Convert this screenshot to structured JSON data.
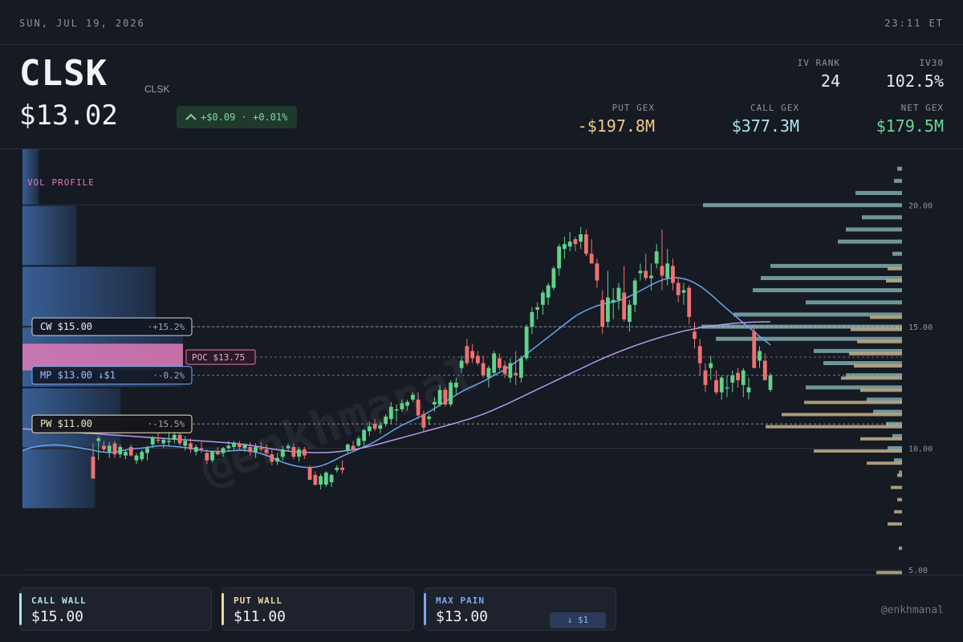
{
  "topbar": {
    "date": "SUN, JUL 19, 2026",
    "time": "23:11 ET"
  },
  "header": {
    "ticker": "CLSK",
    "company": "CLSK",
    "price": "$13.02",
    "change": "+$0.09 · +0.01%",
    "stats": {
      "iv_rank_label": "IV RANK",
      "iv_rank": "24",
      "iv30_label": "IV30",
      "iv30": "102.5%",
      "put_gex_label": "PUT GEX",
      "put_gex": "-$197.8M",
      "call_gex_label": "CALL GEX",
      "call_gex": "$377.3M",
      "net_gex_label": "NET GEX",
      "net_gex": "$179.5M"
    }
  },
  "colors": {
    "up": "#5fd38a",
    "down": "#f07272",
    "call": "#a9e7ee",
    "put": "#f0d9a0",
    "max_pain": "#7aa8f0",
    "poc": "#e07bb8",
    "net_gex": "#6fd59a",
    "put_gex": "#f0c98a"
  },
  "chart_data": {
    "type": "candlestick",
    "title": "",
    "ylim": [
      4.8,
      22.3
    ],
    "y_ticks": [
      "20.00",
      "15.00",
      "10.00",
      "5.00"
    ],
    "volume_profile_label": "VOL PROFILE",
    "levels": [
      {
        "key": "cw",
        "label": "CW $15.00",
        "pct": "+15.2%",
        "price": 15.0
      },
      {
        "key": "mp",
        "label": "MP $13.00 ↓$1",
        "pct": "-0.2%",
        "price": 13.0
      },
      {
        "key": "pw",
        "label": "PW $11.00",
        "pct": "-15.5%",
        "price": 11.0
      },
      {
        "key": "poc",
        "label": "POC $13.75",
        "price": 13.75
      }
    ],
    "volume_profile": [
      {
        "from": 20.0,
        "to": 22.5,
        "value": 0.16
      },
      {
        "from": 17.5,
        "to": 20.0,
        "value": 0.53
      },
      {
        "from": 15.0,
        "to": 17.5,
        "value": 1.3
      },
      {
        "from": 12.5,
        "to": 15.0,
        "value": 1.57
      },
      {
        "from": 10.0,
        "to": 12.5,
        "value": 0.96
      },
      {
        "from": 7.5,
        "to": 10.0,
        "value": 0.71
      }
    ],
    "candles_ohlc": [
      [
        9.65,
        10.2,
        8.75,
        8.75
      ],
      [
        10.3,
        10.5,
        9.5,
        10.4
      ],
      [
        10.1,
        10.3,
        9.85,
        9.95
      ],
      [
        9.85,
        10.25,
        9.6,
        10.1
      ],
      [
        10.2,
        10.3,
        9.6,
        9.75
      ],
      [
        9.75,
        10.15,
        9.6,
        10.05
      ],
      [
        9.7,
        9.95,
        9.55,
        9.85
      ],
      [
        10.05,
        10.15,
        9.65,
        9.7
      ],
      [
        9.5,
        9.8,
        9.35,
        9.7
      ],
      [
        9.55,
        9.95,
        9.45,
        9.85
      ],
      [
        9.8,
        10.1,
        9.5,
        10.0
      ],
      [
        10.15,
        10.5,
        10.0,
        10.45
      ],
      [
        10.35,
        10.65,
        10.2,
        10.3
      ],
      [
        10.2,
        10.4,
        10.0,
        10.35
      ],
      [
        10.25,
        10.7,
        10.1,
        10.3
      ],
      [
        10.35,
        10.7,
        10.2,
        10.55
      ],
      [
        10.55,
        10.7,
        10.1,
        10.2
      ],
      [
        10.1,
        10.5,
        9.9,
        10.3
      ],
      [
        10.2,
        10.4,
        9.8,
        9.95
      ],
      [
        9.85,
        10.15,
        9.7,
        10.05
      ],
      [
        10.0,
        10.3,
        9.8,
        9.95
      ],
      [
        9.8,
        9.95,
        9.35,
        9.5
      ],
      [
        9.5,
        9.9,
        9.4,
        9.85
      ],
      [
        9.85,
        10.05,
        9.7,
        9.75
      ],
      [
        9.8,
        10.05,
        9.65,
        10.0
      ],
      [
        10.0,
        10.3,
        9.85,
        10.1
      ],
      [
        10.05,
        10.3,
        9.9,
        10.2
      ],
      [
        10.2,
        10.3,
        9.9,
        10.05
      ],
      [
        10.0,
        10.2,
        9.85,
        10.15
      ],
      [
        10.05,
        10.25,
        9.7,
        9.85
      ],
      [
        9.85,
        10.2,
        9.6,
        10.05
      ],
      [
        10.0,
        10.25,
        9.85,
        9.95
      ],
      [
        9.95,
        10.15,
        9.65,
        9.8
      ],
      [
        9.75,
        10.0,
        9.3,
        9.45
      ],
      [
        9.45,
        9.8,
        9.3,
        9.6
      ],
      [
        9.65,
        10.1,
        9.5,
        9.95
      ],
      [
        10.0,
        10.2,
        9.9,
        10.1
      ],
      [
        10.05,
        10.2,
        9.55,
        9.65
      ],
      [
        9.65,
        10.05,
        9.45,
        9.95
      ],
      [
        9.95,
        10.05,
        9.55,
        9.7
      ],
      [
        9.2,
        9.3,
        8.7,
        8.7
      ],
      [
        8.9,
        9.05,
        8.45,
        8.5
      ],
      [
        8.5,
        8.95,
        8.3,
        8.85
      ],
      [
        8.5,
        9.05,
        8.4,
        9.0
      ],
      [
        8.6,
        8.95,
        8.4,
        8.9
      ],
      [
        9.1,
        9.3,
        9.0,
        9.2
      ],
      [
        9.2,
        9.5,
        8.95,
        9.1
      ],
      [
        9.9,
        10.2,
        9.8,
        10.15
      ],
      [
        10.1,
        10.3,
        9.9,
        9.95
      ],
      [
        10.1,
        10.5,
        10.05,
        10.4
      ],
      [
        10.3,
        10.8,
        10.0,
        10.75
      ],
      [
        10.7,
        11.1,
        10.5,
        10.9
      ],
      [
        11.0,
        11.2,
        10.7,
        10.8
      ],
      [
        10.8,
        11.1,
        10.6,
        10.95
      ],
      [
        11.0,
        11.4,
        10.9,
        11.3
      ],
      [
        11.2,
        11.9,
        11.0,
        11.7
      ],
      [
        11.6,
        11.8,
        11.1,
        11.6
      ],
      [
        11.6,
        12.0,
        11.5,
        11.85
      ],
      [
        11.75,
        12.0,
        11.55,
        11.9
      ],
      [
        12.0,
        12.3,
        11.9,
        12.2
      ],
      [
        12.0,
        12.3,
        11.2,
        11.35
      ],
      [
        11.4,
        11.55,
        10.7,
        10.85
      ],
      [
        11.2,
        11.4,
        10.95,
        11.3
      ],
      [
        11.8,
        12.1,
        11.5,
        11.9
      ],
      [
        11.8,
        12.6,
        11.7,
        12.4
      ],
      [
        12.4,
        12.5,
        11.7,
        11.8
      ],
      [
        11.8,
        12.8,
        11.7,
        12.7
      ],
      [
        12.5,
        12.9,
        12.2,
        12.7
      ],
      [
        13.3,
        13.8,
        13.1,
        13.6
      ],
      [
        14.2,
        14.5,
        13.4,
        13.5
      ],
      [
        14.0,
        14.3,
        13.5,
        13.7
      ],
      [
        13.8,
        14.0,
        13.4,
        13.5
      ],
      [
        13.5,
        13.8,
        12.9,
        13.0
      ],
      [
        12.9,
        13.4,
        12.5,
        13.3
      ],
      [
        13.1,
        14.0,
        13.0,
        13.9
      ],
      [
        13.7,
        13.9,
        13.2,
        13.3
      ],
      [
        13.4,
        13.6,
        12.9,
        13.05
      ],
      [
        12.9,
        13.7,
        12.7,
        13.5
      ],
      [
        13.1,
        14.0,
        12.6,
        13.0
      ],
      [
        12.9,
        13.8,
        12.7,
        13.7
      ],
      [
        13.7,
        15.1,
        13.6,
        15.0
      ],
      [
        15.0,
        15.8,
        14.7,
        15.6
      ],
      [
        15.7,
        16.0,
        15.3,
        15.8
      ],
      [
        15.9,
        16.5,
        15.5,
        16.4
      ],
      [
        16.2,
        16.8,
        15.9,
        16.7
      ],
      [
        16.6,
        17.5,
        16.5,
        17.4
      ],
      [
        17.4,
        18.4,
        17.1,
        18.3
      ],
      [
        18.2,
        18.7,
        17.8,
        18.4
      ],
      [
        18.3,
        18.9,
        18.1,
        18.5
      ],
      [
        18.6,
        18.7,
        18.1,
        18.4
      ],
      [
        18.5,
        19.1,
        18.2,
        18.8
      ],
      [
        18.8,
        19.0,
        17.9,
        18.0
      ],
      [
        18.0,
        18.6,
        17.6,
        17.6
      ],
      [
        17.6,
        17.8,
        16.6,
        16.9
      ],
      [
        16.1,
        16.5,
        14.7,
        15.0
      ],
      [
        15.2,
        17.3,
        15.0,
        16.2
      ],
      [
        16.0,
        16.6,
        15.3,
        16.1
      ],
      [
        16.1,
        16.8,
        15.7,
        16.6
      ],
      [
        16.4,
        17.5,
        15.2,
        15.3
      ],
      [
        15.2,
        16.1,
        14.8,
        15.9
      ],
      [
        15.9,
        17.0,
        15.6,
        16.9
      ],
      [
        17.2,
        17.6,
        16.9,
        17.3
      ],
      [
        17.3,
        18.0,
        16.9,
        17.0
      ],
      [
        17.0,
        17.6,
        16.5,
        17.1
      ],
      [
        17.6,
        18.4,
        17.4,
        18.1
      ],
      [
        17.5,
        19.0,
        16.5,
        17.1
      ],
      [
        17.0,
        18.2,
        16.7,
        17.6
      ],
      [
        17.5,
        17.8,
        16.5,
        16.8
      ],
      [
        16.8,
        17.0,
        16.0,
        16.3
      ],
      [
        16.4,
        16.8,
        15.9,
        16.5
      ],
      [
        16.6,
        16.7,
        15.1,
        15.4
      ],
      [
        14.8,
        15.2,
        14.1,
        14.5
      ],
      [
        14.2,
        14.5,
        13.0,
        13.5
      ],
      [
        13.2,
        13.5,
        12.3,
        12.6
      ],
      [
        13.3,
        13.8,
        12.8,
        13.5
      ],
      [
        12.8,
        13.2,
        12.2,
        12.3
      ],
      [
        12.3,
        13.0,
        12.0,
        12.9
      ],
      [
        12.5,
        13.0,
        12.1,
        12.5
      ],
      [
        12.7,
        13.2,
        12.3,
        13.0
      ],
      [
        13.1,
        13.3,
        12.5,
        12.8
      ],
      [
        12.6,
        13.3,
        12.1,
        13.2
      ],
      [
        12.3,
        12.9,
        12.0,
        12.5
      ],
      [
        14.8,
        15.1,
        13.3,
        13.3
      ],
      [
        13.6,
        14.2,
        13.3,
        14.0
      ],
      [
        13.6,
        13.9,
        12.8,
        12.8
      ],
      [
        12.4,
        13.1,
        12.3,
        13.0
      ]
    ],
    "moving_averages": [
      {
        "name": "fast",
        "values": [
          9.9,
          10.0,
          10.05,
          10.1,
          10.12,
          10.14,
          10.13,
          10.1,
          10.06,
          10.02,
          9.98,
          9.94,
          9.88,
          9.84,
          9.82,
          9.85,
          9.9,
          9.95,
          9.98,
          10.0,
          10.03,
          10.07,
          10.1,
          10.1,
          10.08,
          10.06,
          10.03,
          10.0,
          9.95,
          9.9,
          9.88,
          9.87,
          9.87,
          9.88,
          9.9,
          9.92,
          9.9,
          9.86,
          9.8,
          9.72,
          9.62,
          9.5,
          9.4,
          9.32,
          9.26,
          9.22,
          9.2,
          9.22,
          9.28,
          9.38,
          9.5,
          9.63,
          9.75,
          9.86,
          9.97,
          10.08,
          10.2,
          10.34,
          10.5,
          10.66,
          10.82,
          10.96,
          11.08,
          11.2,
          11.32,
          11.46,
          11.62,
          11.78,
          11.94,
          12.1,
          12.26,
          12.4,
          12.52,
          12.64,
          12.76,
          12.9,
          13.04,
          13.18,
          13.34,
          13.52,
          13.7,
          13.9,
          14.1,
          14.3,
          14.5,
          14.7,
          14.9,
          15.1,
          15.3,
          15.48,
          15.62,
          15.74,
          15.84,
          15.92,
          15.98,
          16.02,
          16.1,
          16.2,
          16.32,
          16.46,
          16.6,
          16.74,
          16.86,
          16.95,
          17.0,
          17.02,
          16.98,
          16.9,
          16.78,
          16.62,
          16.42,
          16.2,
          15.96,
          15.74,
          15.52,
          15.3,
          15.08,
          14.88,
          14.66,
          14.45,
          14.25
        ]
      },
      {
        "name": "slow",
        "values": [
          10.8,
          10.78,
          10.76,
          10.74,
          10.72,
          10.7,
          10.68,
          10.66,
          10.64,
          10.62,
          10.6,
          10.58,
          10.56,
          10.54,
          10.52,
          10.5,
          10.48,
          10.46,
          10.44,
          10.42,
          10.4,
          10.38,
          10.36,
          10.34,
          10.32,
          10.3,
          10.28,
          10.26,
          10.24,
          10.22,
          10.2,
          10.16,
          10.12,
          10.07,
          10.02,
          9.97,
          9.93,
          9.89,
          9.86,
          9.84,
          9.83,
          9.82,
          9.82,
          9.83,
          9.85,
          9.88,
          9.92,
          9.97,
          10.03,
          10.1,
          10.17,
          10.25,
          10.33,
          10.41,
          10.49,
          10.57,
          10.65,
          10.73,
          10.81,
          10.89,
          10.97,
          11.05,
          11.14,
          11.23,
          11.33,
          11.44,
          11.56,
          11.69,
          11.82,
          11.96,
          12.1,
          12.24,
          12.38,
          12.52,
          12.66,
          12.8,
          12.94,
          13.08,
          13.22,
          13.36,
          13.5,
          13.63,
          13.76,
          13.88,
          14.0,
          14.11,
          14.22,
          14.32,
          14.42,
          14.51,
          14.6,
          14.68,
          14.76,
          14.83,
          14.89,
          14.95,
          15.0,
          15.04,
          15.08,
          15.11,
          15.14,
          15.16,
          15.18,
          15.19,
          15.2,
          15.2
        ]
      }
    ],
    "gex_profile": [
      {
        "price": 21.5,
        "call": 6,
        "put": 0
      },
      {
        "price": 21.0,
        "call": 10,
        "put": 0
      },
      {
        "price": 20.5,
        "call": 58,
        "put": 0
      },
      {
        "price": 20.0,
        "call": 248,
        "put": 0
      },
      {
        "price": 19.5,
        "call": 50,
        "put": 0
      },
      {
        "price": 19.0,
        "call": 70,
        "put": 0
      },
      {
        "price": 18.5,
        "call": 80,
        "put": 0
      },
      {
        "price": 18.0,
        "call": 12,
        "put": 0
      },
      {
        "price": 17.5,
        "call": 164,
        "put": 18
      },
      {
        "price": 17.0,
        "call": 176,
        "put": 20
      },
      {
        "price": 16.5,
        "call": 186,
        "put": 0
      },
      {
        "price": 16.0,
        "call": 120,
        "put": 0
      },
      {
        "price": 15.5,
        "call": 210,
        "put": 40
      },
      {
        "price": 15.0,
        "call": 250,
        "put": 64
      },
      {
        "price": 14.5,
        "call": 232,
        "put": 56
      },
      {
        "price": 14.0,
        "call": 110,
        "put": 66
      },
      {
        "price": 13.5,
        "call": 98,
        "put": 60
      },
      {
        "price": 13.0,
        "call": 70,
        "put": 76
      },
      {
        "price": 12.5,
        "call": 120,
        "put": 52
      },
      {
        "price": 12.0,
        "call": 44,
        "put": 122
      },
      {
        "price": 11.5,
        "call": 36,
        "put": 150
      },
      {
        "price": 11.0,
        "call": 20,
        "put": 170
      },
      {
        "price": 10.5,
        "call": 12,
        "put": 52
      },
      {
        "price": 10.0,
        "call": 18,
        "put": 110
      },
      {
        "price": 9.5,
        "call": 10,
        "put": 44
      },
      {
        "price": 9.0,
        "call": 4,
        "put": 6
      },
      {
        "price": 8.5,
        "call": 0,
        "put": 14
      },
      {
        "price": 8.0,
        "call": 0,
        "put": 6
      },
      {
        "price": 7.5,
        "call": 0,
        "put": 10
      },
      {
        "price": 7.0,
        "call": 0,
        "put": 18
      },
      {
        "price": 6.0,
        "call": 0,
        "put": 4
      },
      {
        "price": 5.0,
        "call": 0,
        "put": 32
      }
    ]
  },
  "footer": {
    "call_wall_label": "CALL WALL",
    "call_wall": "$15.00",
    "put_wall_label": "PUT WALL",
    "put_wall": "$11.00",
    "max_pain_label": "MAX PAIN",
    "max_pain": "$13.00",
    "max_pain_chip": "↓ $1",
    "handle": "@enkhmanal"
  },
  "watermark": "@enkhmanal"
}
